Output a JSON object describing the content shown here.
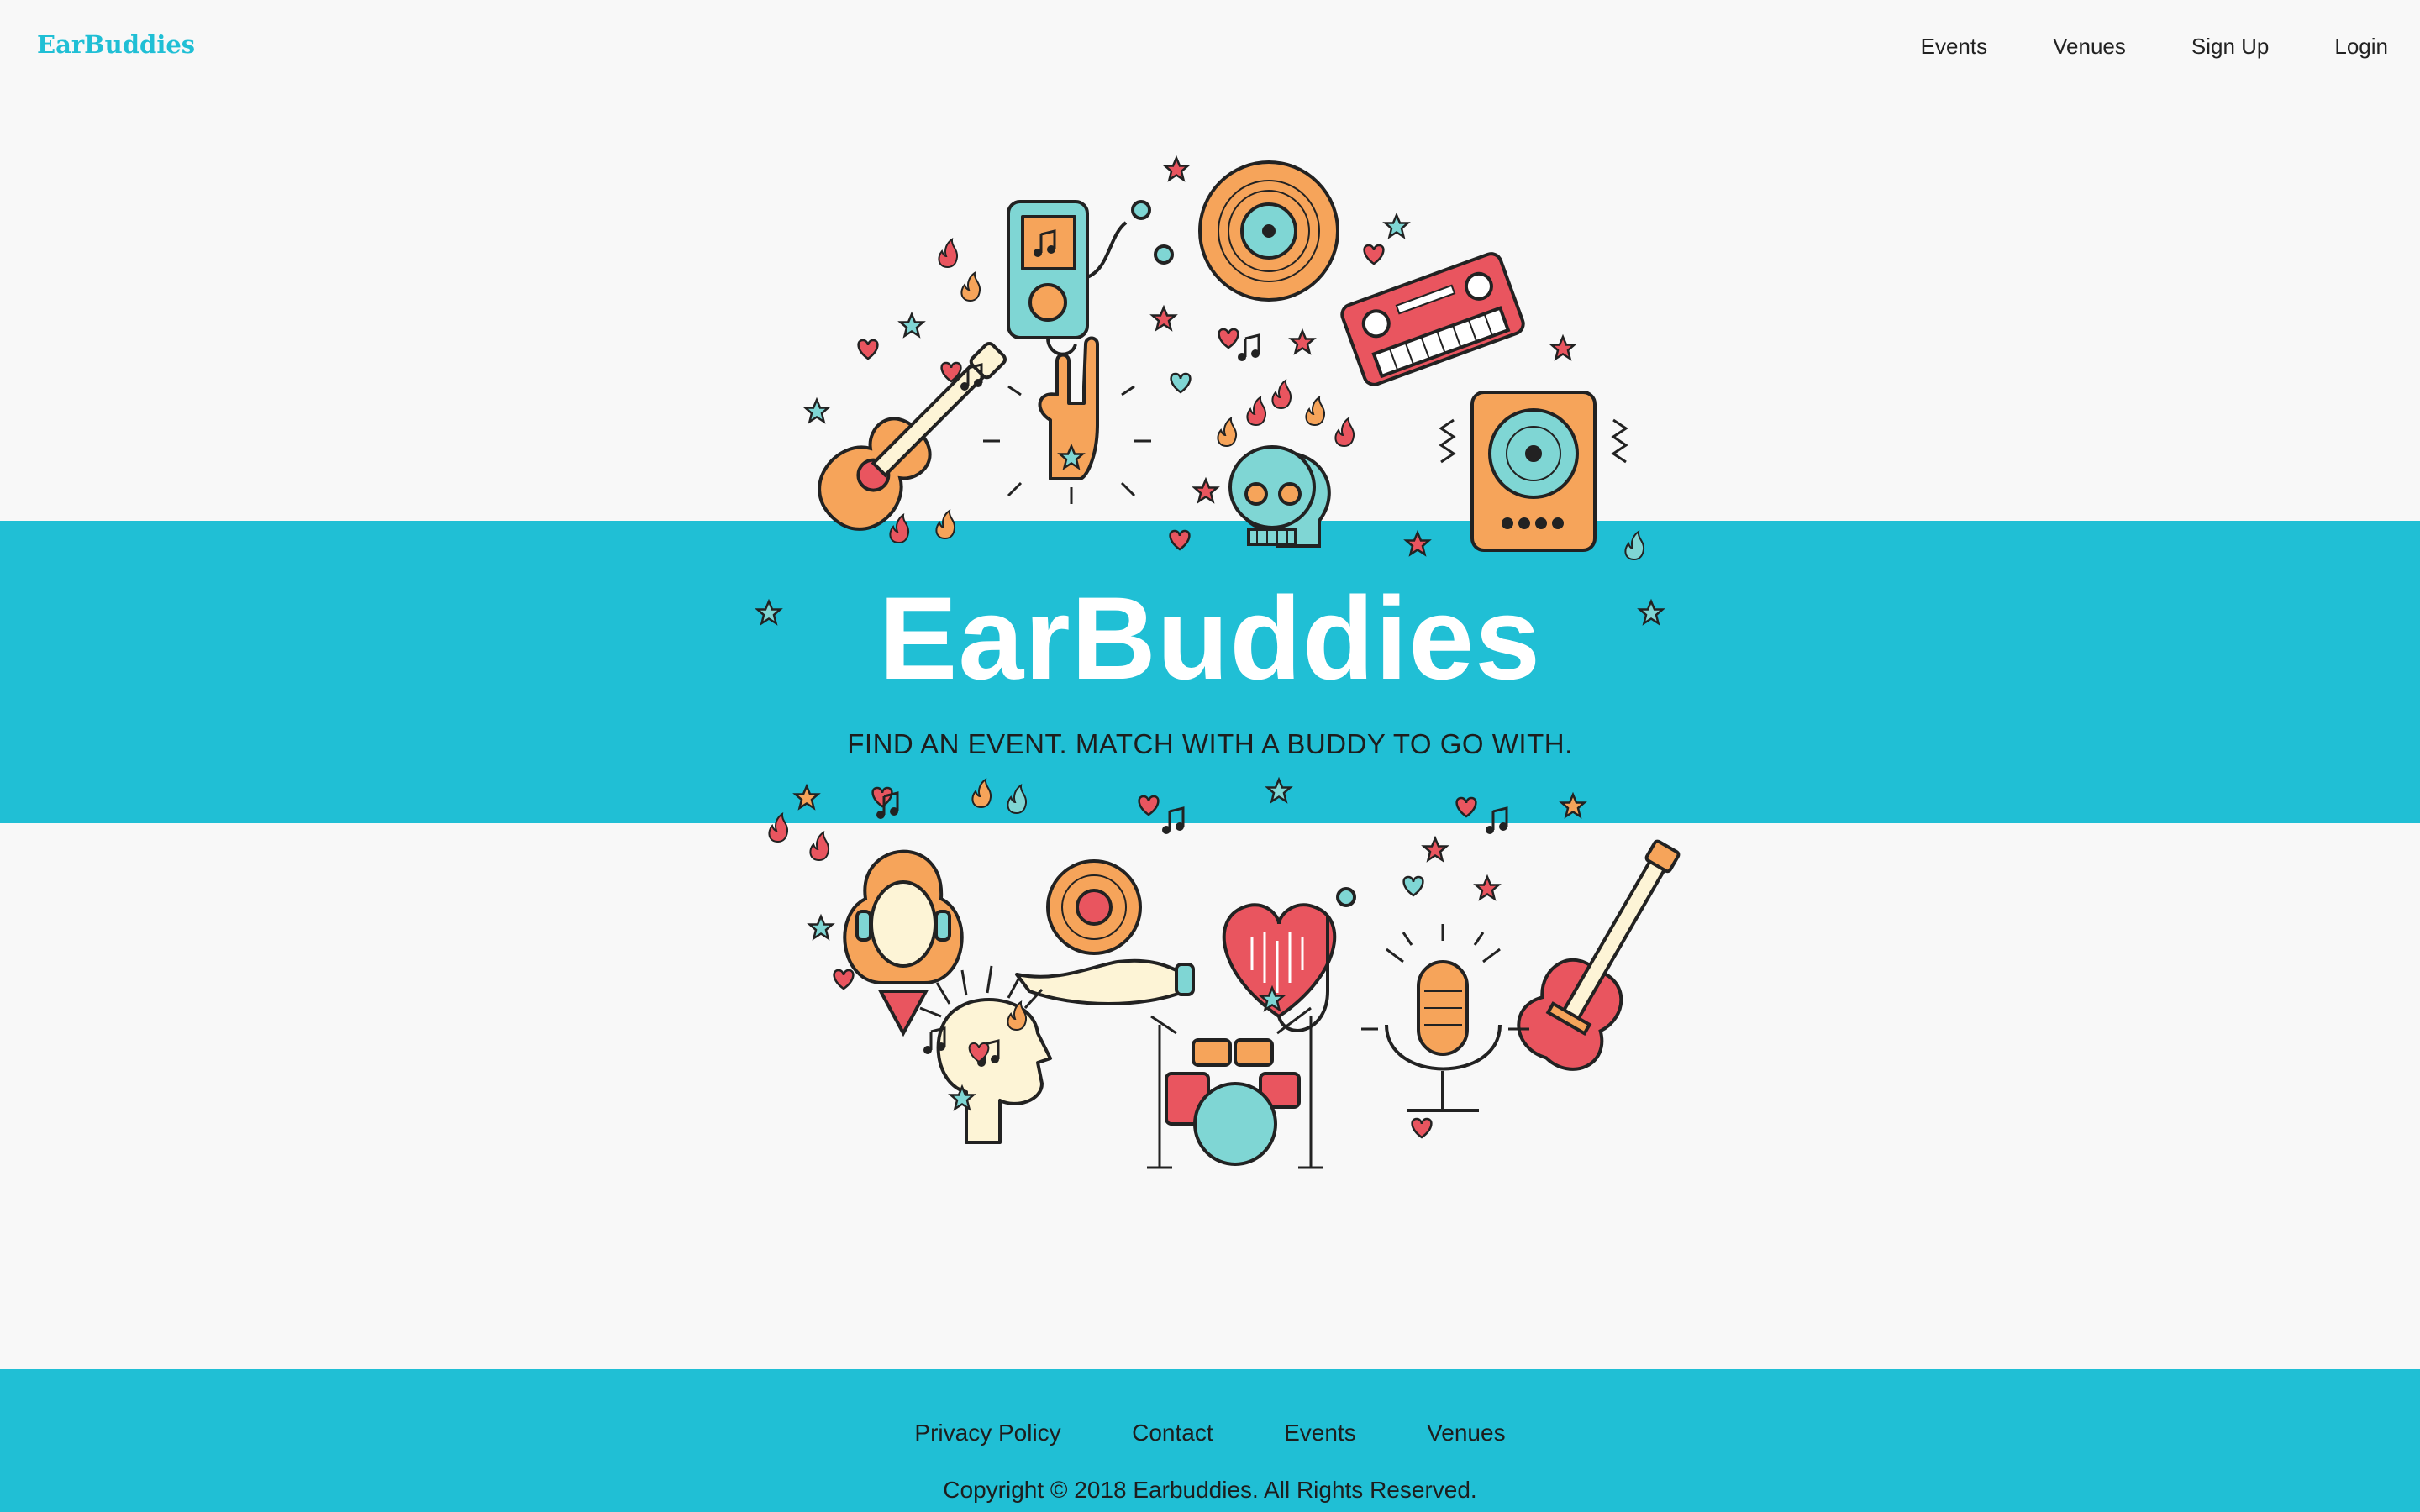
{
  "header": {
    "brand": "EarBuddies",
    "nav": [
      {
        "label": "Events"
      },
      {
        "label": "Venues"
      },
      {
        "label": "Sign Up"
      },
      {
        "label": "Login"
      }
    ]
  },
  "hero": {
    "title": "EarBuddies",
    "subtitle": "FIND AN EVENT. MATCH WITH A BUDDY TO GO WITH."
  },
  "footer": {
    "links": [
      {
        "label": "Privacy Policy"
      },
      {
        "label": "Contact"
      },
      {
        "label": "Events"
      },
      {
        "label": "Venues"
      }
    ],
    "copyright": "Copyright © 2018 Earbuddies. All Rights Reserved."
  },
  "colors": {
    "accent": "#20bfd5",
    "orange": "#f6a45a",
    "red": "#e9555f",
    "mint": "#7fd6d4",
    "cream": "#fdf4d6",
    "outline": "#222222",
    "background": "#f8f8f8"
  },
  "icons": [
    "music-player-icon",
    "vinyl-record-icon",
    "keyboard-synth-icon",
    "acoustic-guitar-icon",
    "rock-hand-icon",
    "skull-icon",
    "speaker-icon",
    "woman-headphones-icon",
    "record-in-hand-icon",
    "heart-icon",
    "electric-guitar-icon",
    "head-music-icon",
    "drum-kit-icon",
    "microphone-icon",
    "star-icon",
    "flame-icon",
    "music-note-icon"
  ]
}
